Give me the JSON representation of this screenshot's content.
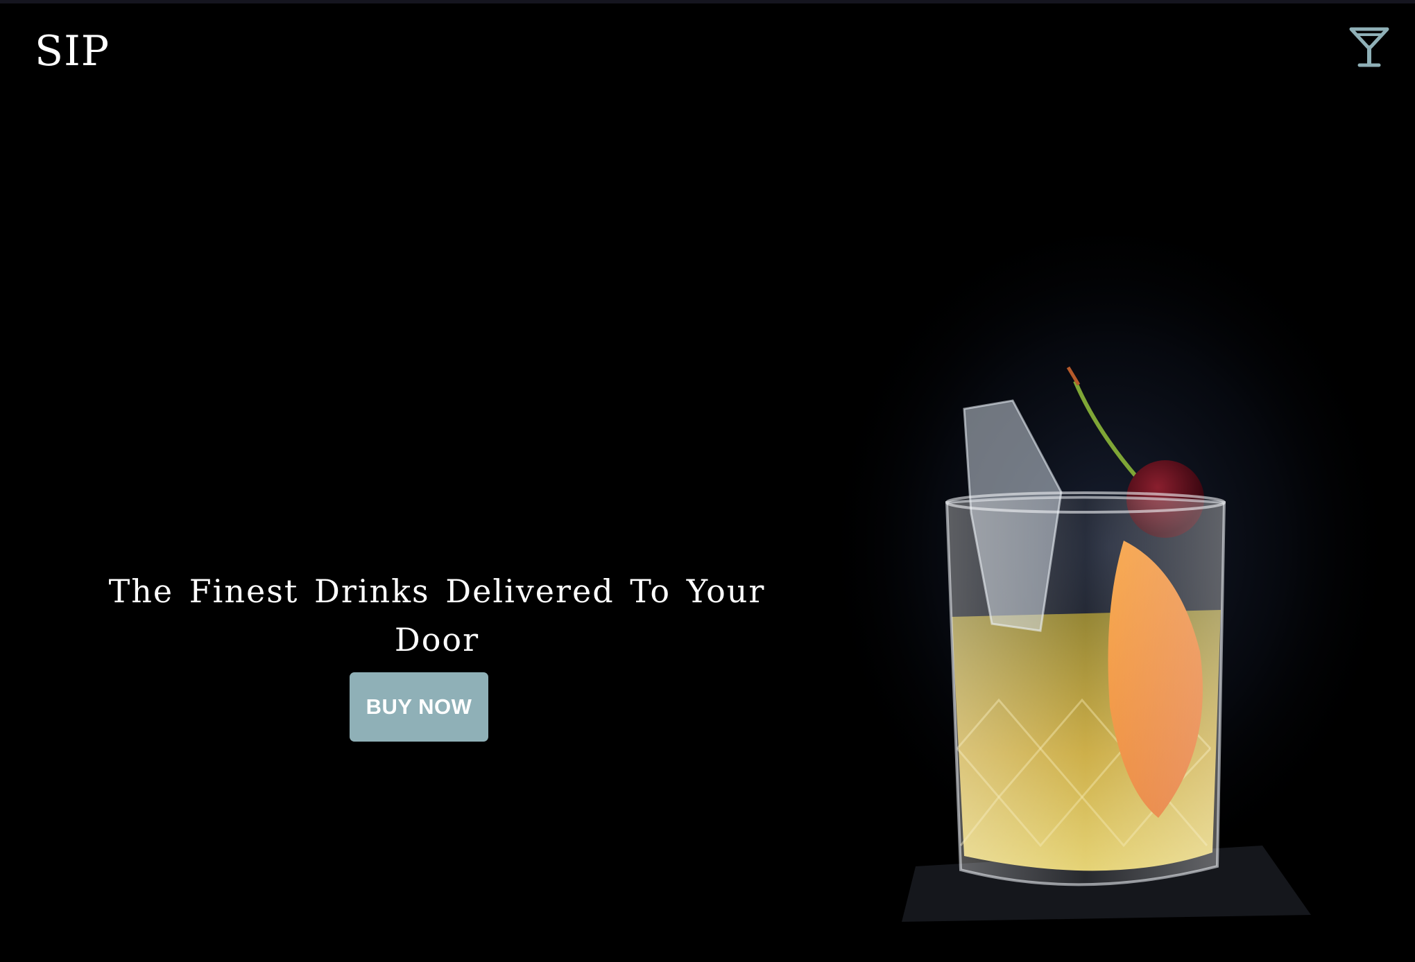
{
  "header": {
    "logo_text": "SIP",
    "menu_icon": "cocktail-glass-icon"
  },
  "hero": {
    "tagline": "The Finest Drinks Delivered To Your Door",
    "cta_label": "BUY NOW",
    "image_subject": "cocktail-photo"
  },
  "colors": {
    "background": "#000000",
    "accent": "#8fb0b7",
    "text": "#ffffff"
  }
}
